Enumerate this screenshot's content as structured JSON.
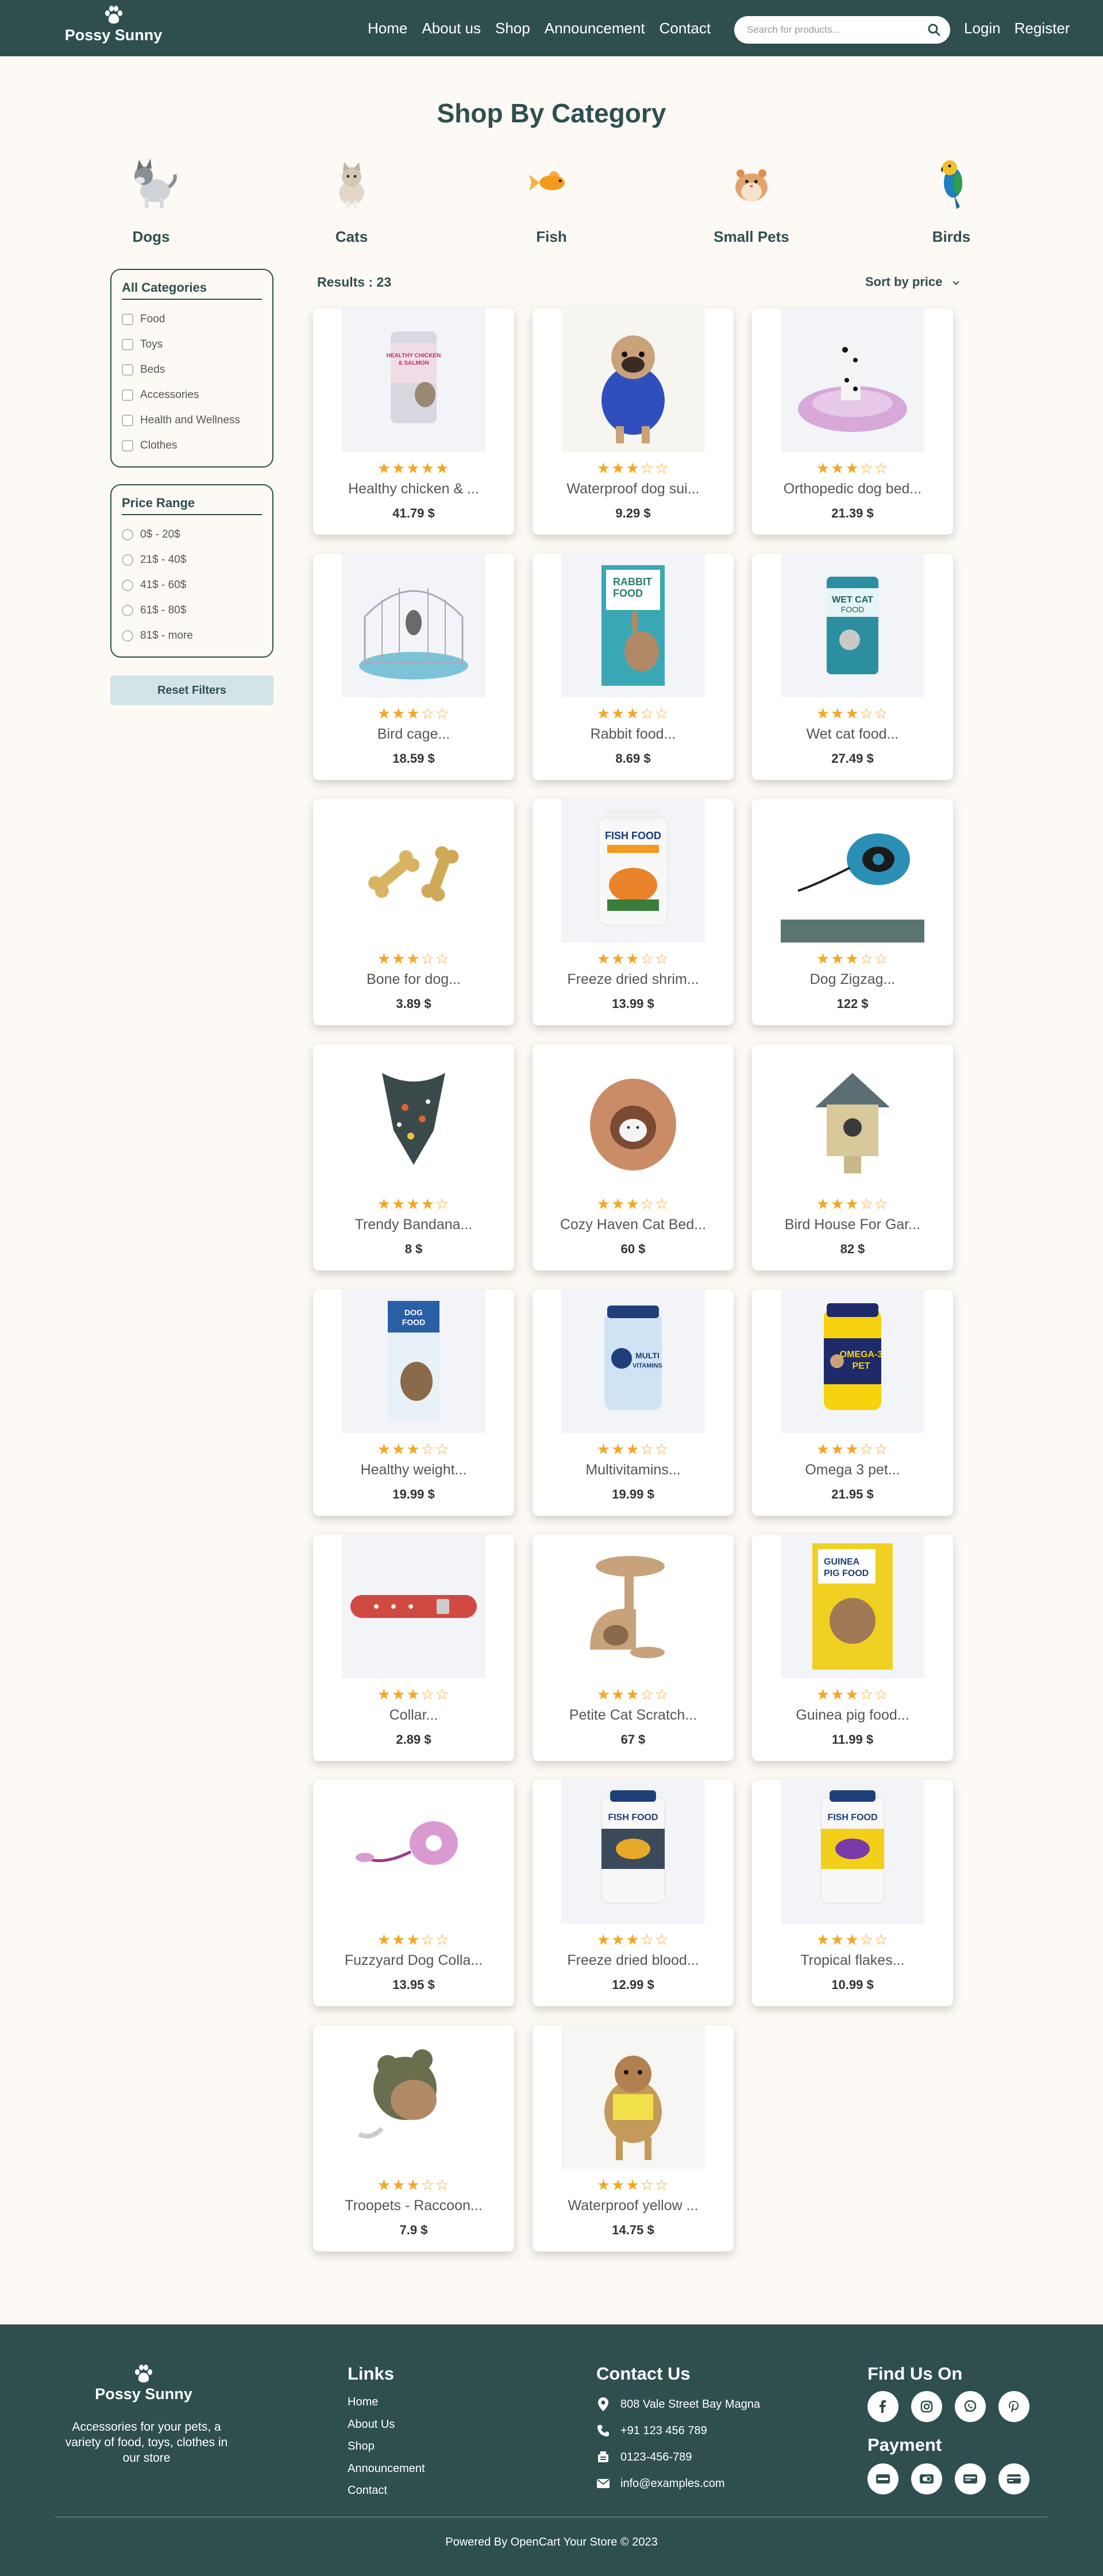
{
  "brand": {
    "name": "Possy Sunny"
  },
  "nav": {
    "items": [
      "Home",
      "About us",
      "Shop",
      "Announcement",
      "Contact"
    ]
  },
  "search": {
    "placeholder": "Search for products..."
  },
  "auth": {
    "login": "Login",
    "register": "Register"
  },
  "categories": {
    "title": "Shop By Category",
    "items": [
      "Dogs",
      "Cats",
      "Fish",
      "Small Pets",
      "Birds"
    ]
  },
  "filters": {
    "categories_title": "All Categories",
    "categories": [
      "Food",
      "Toys",
      "Beds",
      "Accessories",
      "Health and Wellness",
      "Clothes"
    ],
    "price_title": "Price Range",
    "prices": [
      "0$ - 20$",
      "21$ - 40$",
      "41$ - 60$",
      "61$ - 80$",
      "81$ - more"
    ],
    "reset_label": "Reset Filters"
  },
  "results": {
    "label": "Results : 23",
    "sort_label": "Sort by price"
  },
  "products": [
    {
      "name": "Healthy chicken & ...",
      "price": "41.79 $",
      "rating": 5
    },
    {
      "name": "Waterproof dog sui...",
      "price": "9.29 $",
      "rating": 3
    },
    {
      "name": "Orthopedic dog bed...",
      "price": "21.39 $",
      "rating": 3
    },
    {
      "name": "Bird cage...",
      "price": "18.59 $",
      "rating": 3
    },
    {
      "name": "Rabbit food...",
      "price": "8.69 $",
      "rating": 3
    },
    {
      "name": "Wet cat food...",
      "price": "27.49 $",
      "rating": 3
    },
    {
      "name": "Bone for dog...",
      "price": "3.89 $",
      "rating": 3
    },
    {
      "name": "Freeze dried shrim...",
      "price": "13.99 $",
      "rating": 3
    },
    {
      "name": "Dog Zigzag...",
      "price": "122 $",
      "rating": 3
    },
    {
      "name": "Trendy Bandana...",
      "price": "8 $",
      "rating": 4
    },
    {
      "name": "Cozy Haven Cat Bed...",
      "price": "60 $",
      "rating": 3
    },
    {
      "name": "Bird House For Gar...",
      "price": "82 $",
      "rating": 3
    },
    {
      "name": "Healthy weight...",
      "price": "19.99 $",
      "rating": 3
    },
    {
      "name": "Multivitamins...",
      "price": "19.99 $",
      "rating": 3
    },
    {
      "name": "Omega 3 pet...",
      "price": "21.95 $",
      "rating": 3
    },
    {
      "name": "Collar...",
      "price": "2.89 $",
      "rating": 3
    },
    {
      "name": "Petite Cat Scratch...",
      "price": "67 $",
      "rating": 3
    },
    {
      "name": "Guinea pig food...",
      "price": "11.99 $",
      "rating": 3
    },
    {
      "name": "Fuzzyard Dog Colla...",
      "price": "13.95 $",
      "rating": 3
    },
    {
      "name": "Freeze dried blood...",
      "price": "12.99 $",
      "rating": 3
    },
    {
      "name": "Tropical flakes...",
      "price": "10.99 $",
      "rating": 3
    },
    {
      "name": "Troopets - Raccoon...",
      "price": "7.9 $",
      "rating": 3
    },
    {
      "name": "Waterproof yellow ...",
      "price": "14.75 $",
      "rating": 3
    }
  ],
  "footer": {
    "description": "Accessories for your pets, a variety of food, toys, clothes in our store",
    "links_title": "Links",
    "links": [
      "Home",
      "About Us",
      "Shop",
      "Announcement",
      "Contact"
    ],
    "contact_title": "Contact Us",
    "address": "808 Vale Street Bay Magna",
    "phone": "+91 123 456 789",
    "fax": "0123-456-789",
    "email": "info@examples.com",
    "find_title": "Find Us On",
    "payment_title": "Payment",
    "copyright": "Powered By OpenCart Your Store © 2023"
  },
  "colors": {
    "primary": "#2f4f4f",
    "background": "#fdf9f4",
    "star": "#f5a623",
    "reset_bg": "#d2e4e8"
  }
}
